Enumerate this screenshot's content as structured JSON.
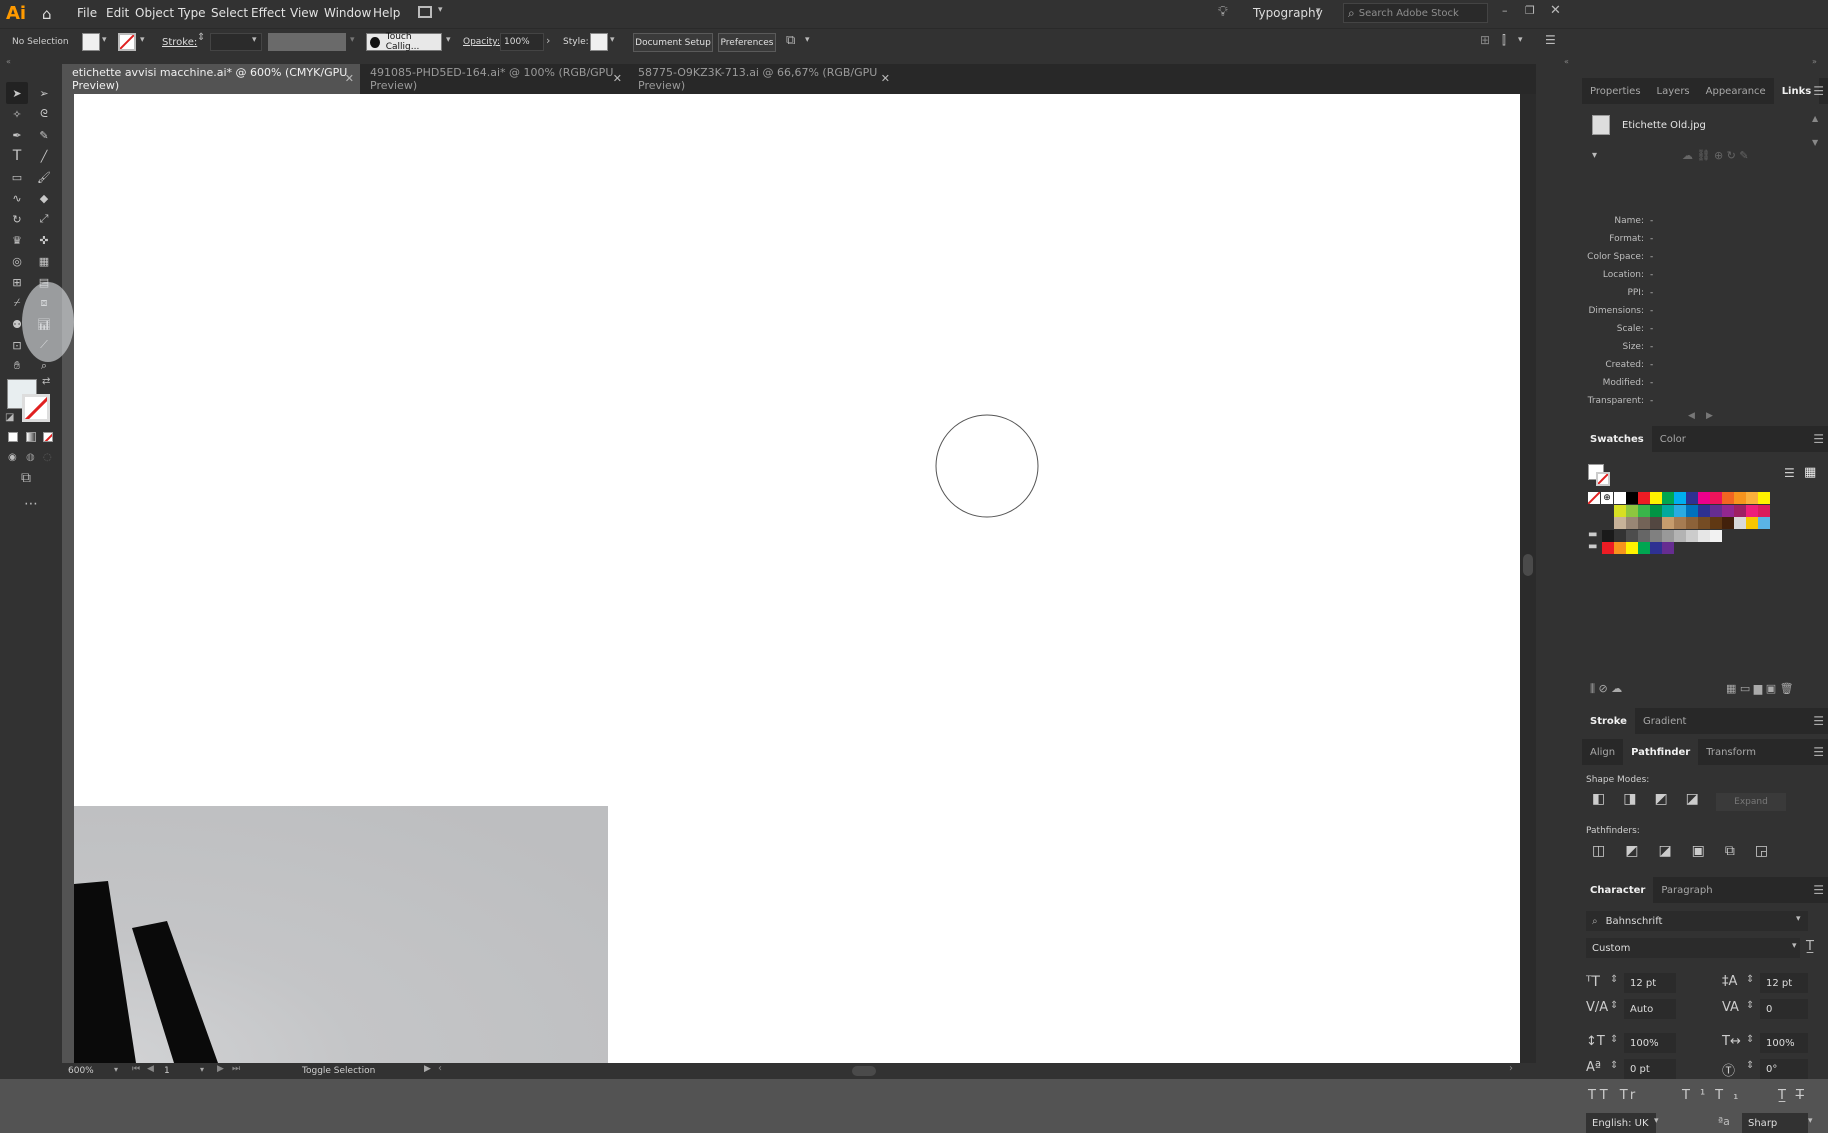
{
  "app": {
    "logo": "Ai"
  },
  "menubar": {
    "items": [
      "File",
      "Edit",
      "Object",
      "Type",
      "Select",
      "Effect",
      "View",
      "Window",
      "Help"
    ],
    "workspace": "Typography",
    "search_placeholder": "Search Adobe Stock"
  },
  "controlbar": {
    "selection": "No Selection",
    "stroke_label": "Stroke:",
    "brush": "Touch Callig...",
    "opacity_label": "Opacity:",
    "opacity_value": "100%",
    "style_label": "Style:",
    "document_setup": "Document Setup",
    "preferences": "Preferences"
  },
  "tabs": [
    {
      "label": "etichette avvisi macchine.ai* @ 600% (CMYK/GPU Preview)",
      "active": true
    },
    {
      "label": "491085-PHD5ED-164.ai* @ 100% (RGB/GPU Preview)",
      "active": false
    },
    {
      "label": "58775-O9KZ3K-713.ai @ 66,67% (RGB/GPU Preview)",
      "active": false
    }
  ],
  "statusbar": {
    "zoom": "600%",
    "page": "1",
    "info": "Toggle Selection"
  },
  "links_panel": {
    "tabs": [
      "Properties",
      "Layers",
      "Appearance",
      "Links"
    ],
    "active_tab": "Links",
    "file": "Etichette Old.jpg",
    "fields": [
      {
        "label": "Name:",
        "value": "-"
      },
      {
        "label": "Format:",
        "value": "-"
      },
      {
        "label": "Color Space:",
        "value": "-"
      },
      {
        "label": "Location:",
        "value": "-"
      },
      {
        "label": "PPI:",
        "value": "-"
      },
      {
        "label": "Dimensions:",
        "value": "-"
      },
      {
        "label": "Scale:",
        "value": "-"
      },
      {
        "label": "Size:",
        "value": "-"
      },
      {
        "label": "Created:",
        "value": "-"
      },
      {
        "label": "Modified:",
        "value": "-"
      },
      {
        "label": "Transparent:",
        "value": "-"
      }
    ]
  },
  "swatches_panel": {
    "tabs": [
      "Swatches",
      "Color"
    ],
    "row1": [
      "#ffffff",
      "#000000",
      "#ed1c24",
      "#fff200",
      "#00a651",
      "#00aeef",
      "#2e3192",
      "#ec008c",
      "#ed145b",
      "#f26522",
      "#f7941d",
      "#fbb03b",
      "#fff200"
    ],
    "row2": [
      "#d7df23",
      "#8dc63f",
      "#39b54a",
      "#009444",
      "#00a99d",
      "#29abe2",
      "#0071bc",
      "#2e3192",
      "#662d91",
      "#92278f",
      "#9e1f63",
      "#ed1e79",
      "#da1c5c"
    ],
    "row3": [
      "#c7b299",
      "#998675",
      "#736357",
      "#534741",
      "#c69c6d",
      "#a67c52",
      "#8c6239",
      "#754c24",
      "#603813",
      "#42210b",
      "#d9d9d9",
      "#f7c600",
      "#5ab4e6"
    ],
    "row4": [
      "#1a1a1a",
      "#333333",
      "#4d4d4d",
      "#666666",
      "#808080",
      "#999999",
      "#b3b3b3",
      "#cccccc",
      "#e6e6e6",
      "#f2f2f2"
    ],
    "row5": [
      "#ed1c24",
      "#f7941d",
      "#fff200",
      "#00a651",
      "#2e3192",
      "#662d91"
    ]
  },
  "stroke_panel": {
    "tabs": [
      "Stroke",
      "Gradient"
    ]
  },
  "pathfinder_panel": {
    "tabs": [
      "Align",
      "Pathfinder",
      "Transform"
    ],
    "shape_modes": "Shape Modes:",
    "expand": "Expand",
    "pathfinders": "Pathfinders:"
  },
  "character_panel": {
    "tabs": [
      "Character",
      "Paragraph"
    ],
    "font": "Bahnschrift",
    "style": "Custom",
    "size": "12 pt",
    "leading": "12 pt",
    "kerning": "Auto",
    "tracking": "0",
    "vscale": "100%",
    "hscale": "100%",
    "baseline": "0 pt",
    "rotation": "0°",
    "language": "English: UK",
    "antialias": "Sharp"
  }
}
